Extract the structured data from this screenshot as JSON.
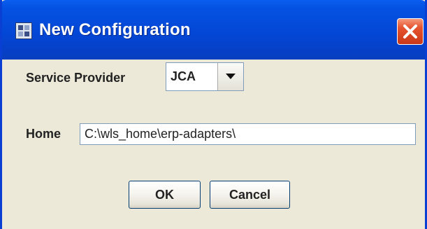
{
  "window": {
    "title": "New Configuration",
    "title_icon": "app-window-icon",
    "close_icon": "close-icon",
    "colors": {
      "titlebar": "#0347d6",
      "frame": "#0a3fd4",
      "body": "#ece9d8",
      "close_button": "#d7441f"
    }
  },
  "form": {
    "service_provider": {
      "label": "Service Provider",
      "value": "JCA",
      "dropdown_icon": "chevron-down-icon"
    },
    "home": {
      "label": "Home",
      "value": "C:\\wls_home\\erp-adapters\\"
    }
  },
  "buttons": {
    "ok": "OK",
    "cancel": "Cancel"
  }
}
